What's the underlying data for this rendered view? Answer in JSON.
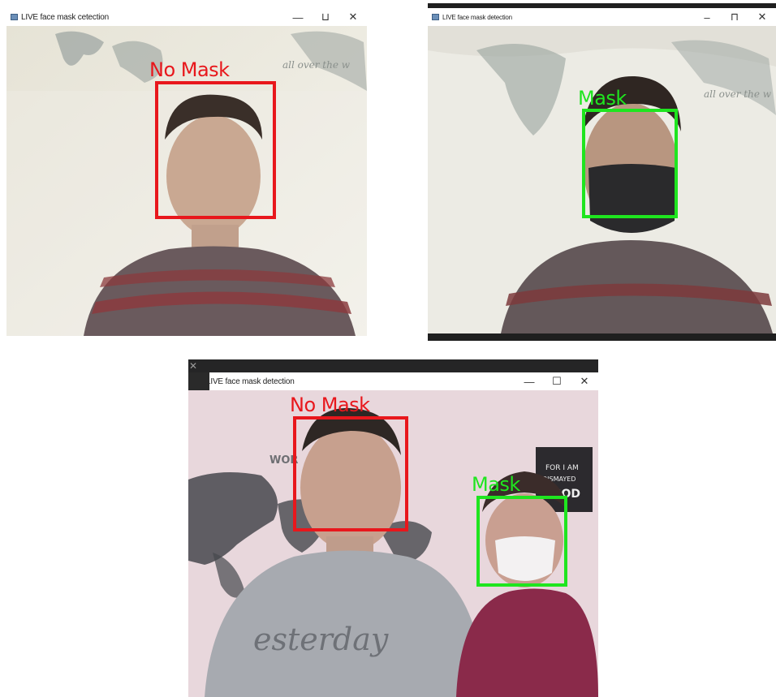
{
  "windows": [
    {
      "id": "top-left",
      "title": "LIVE face mask cetection",
      "controls": [
        "—",
        "⊔",
        "✕"
      ],
      "detections": [
        {
          "label": "No Mask",
          "status": "no-mask"
        }
      ]
    },
    {
      "id": "top-right",
      "title": "LIVE face mask detection",
      "controls": [
        "–",
        "⊓",
        "✕"
      ],
      "detections": [
        {
          "label": "Mask",
          "status": "mask"
        }
      ]
    },
    {
      "id": "bottom",
      "title": "LIVE face mask detection",
      "controls": [
        "—",
        "☐",
        "✕"
      ],
      "detections": [
        {
          "label": "No Mask",
          "status": "no-mask"
        },
        {
          "label": "Mask",
          "status": "mask"
        }
      ]
    }
  ],
  "background_close": "✕",
  "colors": {
    "no_mask": "#e8171c",
    "mask": "#1fe51f"
  },
  "icons": {
    "window_icon": "app-window-icon"
  }
}
